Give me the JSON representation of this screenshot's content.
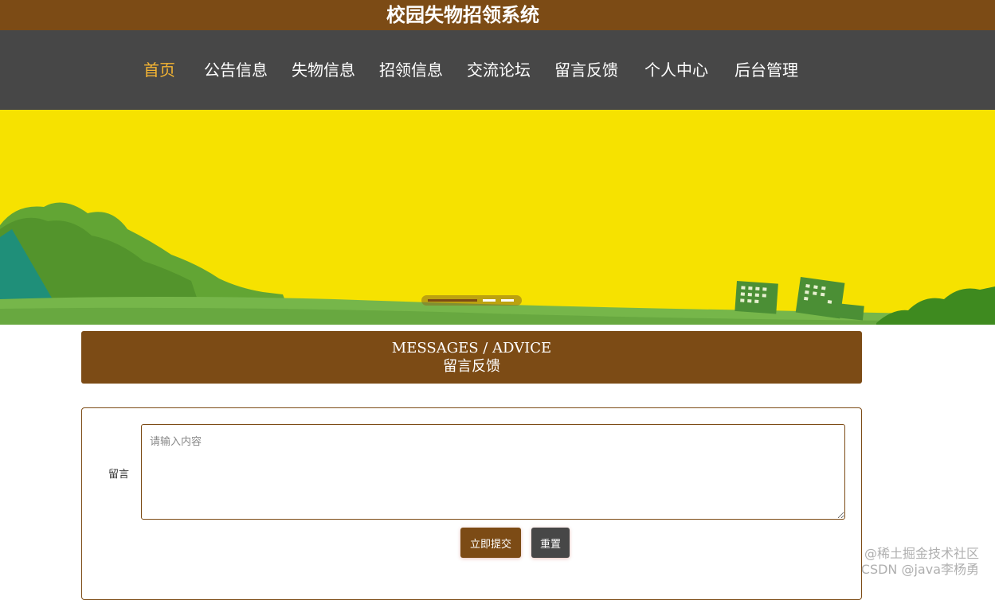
{
  "header": {
    "title": "校园失物招领系统"
  },
  "nav": {
    "items": [
      {
        "label": "首页",
        "active": true
      },
      {
        "label": "公告信息",
        "active": false
      },
      {
        "label": "失物信息",
        "active": false
      },
      {
        "label": "招领信息",
        "active": false
      },
      {
        "label": "交流论坛",
        "active": false
      },
      {
        "label": "留言反馈",
        "active": false
      },
      {
        "label": "个人中心",
        "active": false
      },
      {
        "label": "后台管理",
        "active": false
      }
    ]
  },
  "banner": {
    "slide_count": 3,
    "active_slide": 1
  },
  "section": {
    "title_en": "MESSAGES / ADVICE",
    "title_cn": "留言反馈"
  },
  "form": {
    "label": "留言",
    "placeholder": "请输入内容",
    "value": "",
    "submit_label": "立即提交",
    "reset_label": "重置"
  },
  "watermark": {
    "line1": "@稀土掘金技术社区",
    "line2": "CSDN @java李杨勇"
  },
  "colors": {
    "brand_brown": "#7c4b15",
    "nav_bg": "#474747",
    "nav_active": "#f5b533",
    "banner_yellow": "#f6e200"
  }
}
